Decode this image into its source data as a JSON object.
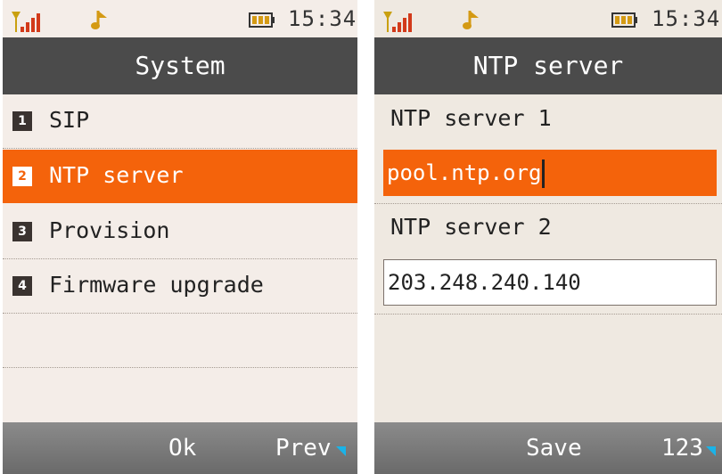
{
  "left": {
    "status": {
      "time": "15:34"
    },
    "title": "System",
    "menu": [
      {
        "num": "1",
        "label": "SIP"
      },
      {
        "num": "2",
        "label": "NTP server"
      },
      {
        "num": "3",
        "label": "Provision"
      },
      {
        "num": "4",
        "label": "Firmware upgrade"
      }
    ],
    "selected_index": 1,
    "softkeys": {
      "center": "Ok",
      "right": "Prev"
    }
  },
  "right": {
    "status": {
      "time": "15:34"
    },
    "title": "NTP server",
    "fields": [
      {
        "label": "NTP server 1",
        "value": "pool.ntp.org"
      },
      {
        "label": "NTP server 2",
        "value": "203.248.240.140"
      }
    ],
    "softkeys": {
      "center": "Save",
      "right": "123"
    }
  },
  "colors": {
    "accent": "#f4630b",
    "titlebar": "#4b4b4b",
    "softkey_arrow": "#1ab3e8"
  }
}
